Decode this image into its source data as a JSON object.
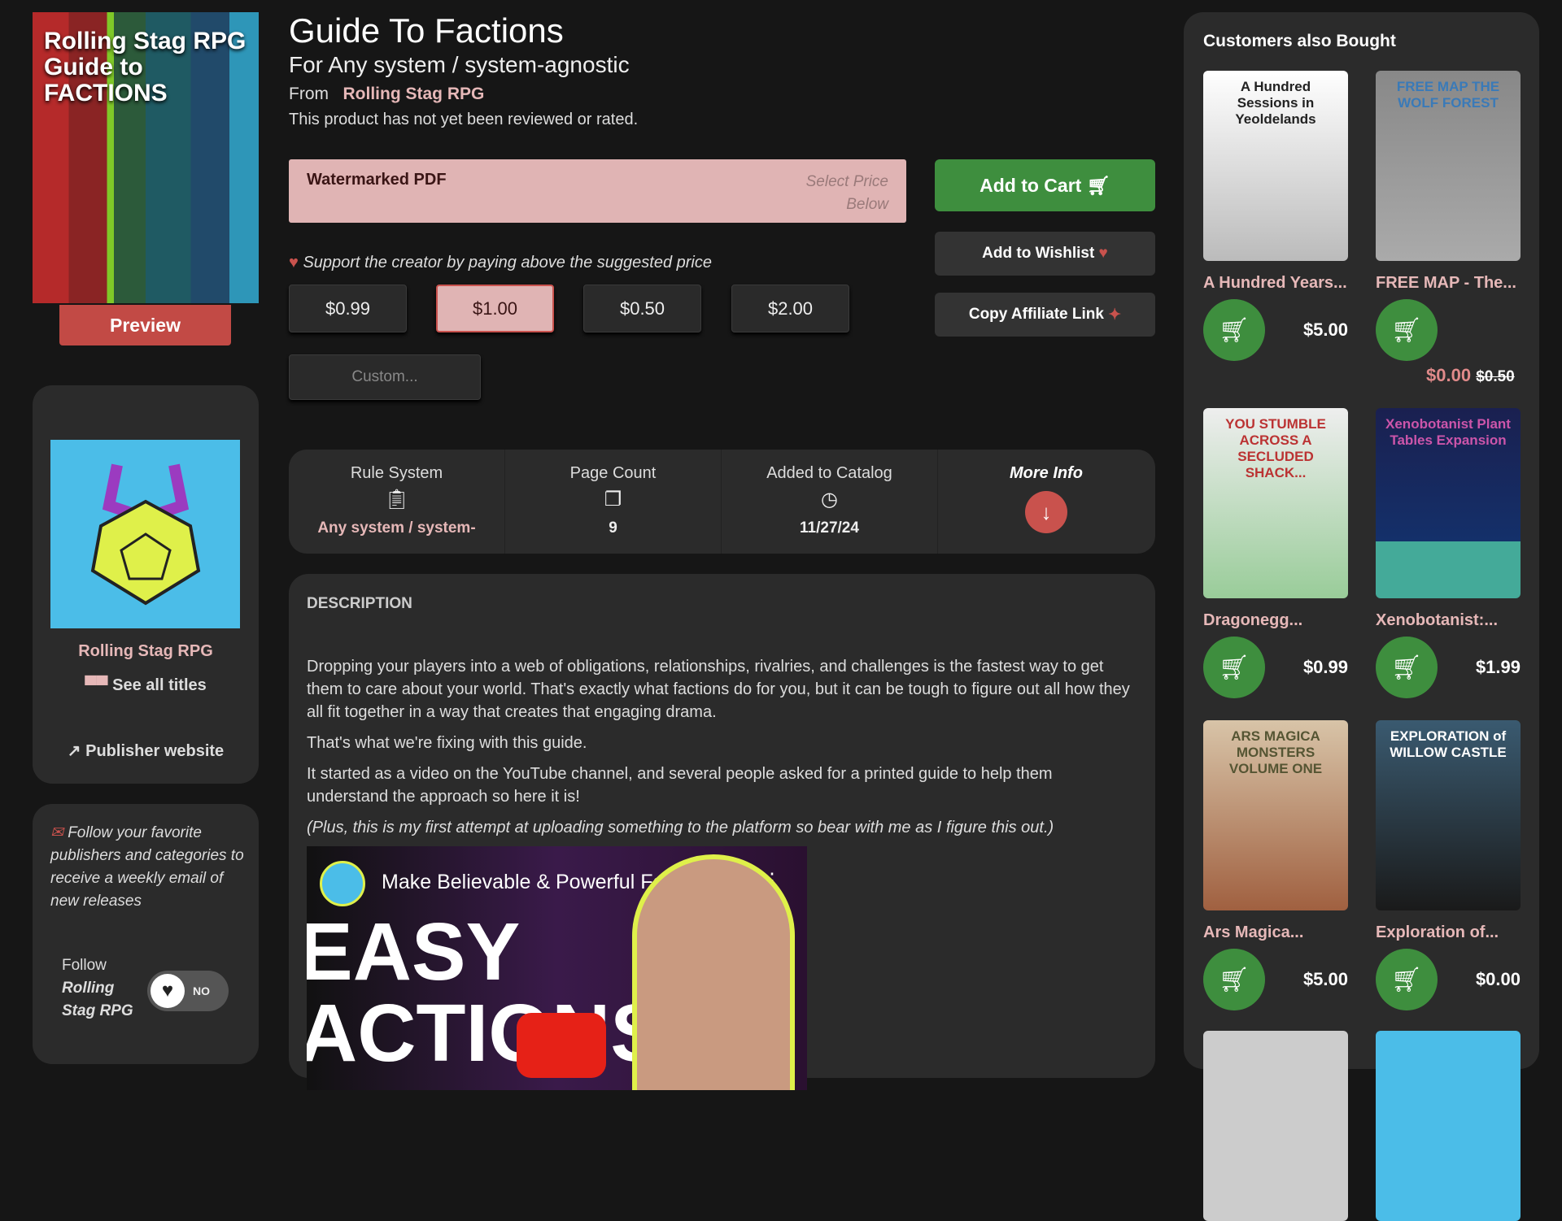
{
  "product": {
    "title": "Guide To Factions",
    "subtitle": "For Any system / system-agnostic",
    "from_label": "From",
    "publisher": "Rolling Stag RPG",
    "rating_text": "This product has not yet been reviewed or rated.",
    "cover_text": "Rolling Stag RPG Guide to FACTIONS",
    "preview_label": "Preview"
  },
  "format": {
    "name": "Watermarked PDF",
    "price_hint_1": "Select Price",
    "price_hint_2": "Below"
  },
  "actions": {
    "add_to_cart": "Add to Cart",
    "add_to_wishlist": "Add to Wishlist",
    "copy_affiliate": "Copy Affiliate Link"
  },
  "support_text": "Support the creator by paying above the suggested price",
  "prices": [
    {
      "label": "$0.99",
      "selected": false
    },
    {
      "label": "$1.00",
      "selected": true
    },
    {
      "label": "$0.50",
      "selected": false
    },
    {
      "label": "$2.00",
      "selected": false
    }
  ],
  "custom_placeholder": "Custom...",
  "info": {
    "rule_label": "Rule System",
    "rule_value": "Any system / system-",
    "pages_label": "Page Count",
    "pages_value": "9",
    "added_label": "Added to Catalog",
    "added_value": "11/27/24",
    "more_label": "More Info"
  },
  "description": {
    "heading": "DESCRIPTION",
    "paragraphs": [
      "Dropping your players into a web of obligations, relationships, rivalries, and challenges is the fastest way to get them to care about your world. That's exactly what factions do for you, but it can be tough to figure out all how they all fit together in a way  that creates that engaging drama.",
      "That's what we're fixing with this guide.",
      "It started as a video on the YouTube channel, and several people asked for a printed guide to help them understand the approach so here it is!",
      "(Plus, this is my first attempt at uploading something to the platform so bear with me as I figure this out.)"
    ],
    "video_title": "Make Believable & Powerful Faction...",
    "video_text": "EASY ACTIONS"
  },
  "publisher_card": {
    "name": "Rolling Stag RPG",
    "see_all": "See all titles",
    "website": "Publisher website"
  },
  "follow": {
    "text": "Follow your favorite publishers and categories to receive a weekly email of new releases",
    "follow_label": "Follow",
    "follow_name": "Rolling Stag RPG",
    "toggle_state": "NO"
  },
  "also_bought": {
    "title": "Customers also Bought",
    "items": [
      {
        "title": "A Hundred Years...",
        "price": "$5.00",
        "cover": "A Hundred Sessions in Yeoldelands"
      },
      {
        "title": "FREE MAP - The...",
        "price": "$0.00",
        "old_price": "$0.50",
        "cover": "FREE MAP THE WOLF FOREST"
      },
      {
        "title": "Dragonegg...",
        "price": "$0.99",
        "cover": "YOU STUMBLE ACROSS A SECLUDED SHACK..."
      },
      {
        "title": "Xenobotanist:...",
        "price": "$1.99",
        "cover": "Xenobotanist Plant Tables Expansion"
      },
      {
        "title": "Ars Magica...",
        "price": "$5.00",
        "cover": "ARS MAGICA MONSTERS VOLUME ONE"
      },
      {
        "title": "Exploration of...",
        "price": "$0.00",
        "cover": "EXPLORATION of WILLOW CASTLE"
      }
    ]
  },
  "colors": {
    "accent_pink": "#e0b4b4",
    "green": "#3e8e3e",
    "red": "#c9524d",
    "panel": "#2b2b2b",
    "background": "#161616"
  }
}
